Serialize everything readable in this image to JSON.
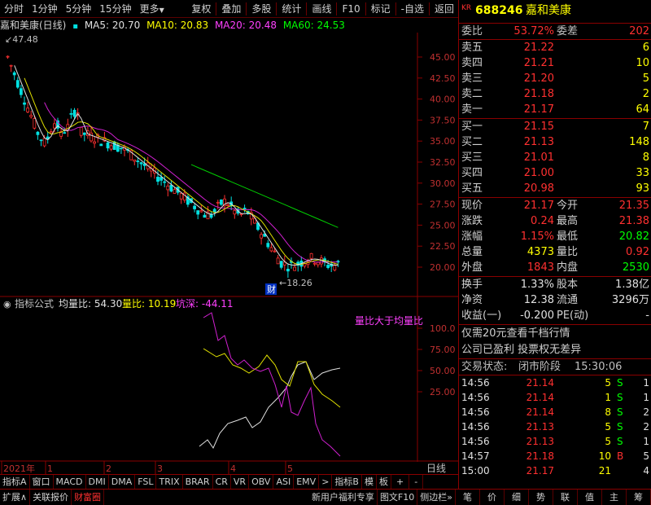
{
  "toolbar": {
    "left": [
      "分时",
      "1分钟",
      "5分钟",
      "15分钟",
      "更多"
    ],
    "right": [
      "复权",
      "叠加",
      "多股",
      "统计",
      "画线",
      "F10",
      "标记",
      "-自选",
      "返回"
    ]
  },
  "chart_header": {
    "name": "嘉和美康(日线)",
    "ma5": "MA5: 20.70",
    "ma10": "MA10: 20.83",
    "ma20": "MA20: 20.48",
    "ma60": "MA60: 24.53"
  },
  "price_axis": [
    "45.00",
    "42.50",
    "40.00",
    "37.50",
    "35.00",
    "32.50",
    "30.00",
    "27.50",
    "25.00",
    "22.50",
    "20.00"
  ],
  "max_label": "47.48",
  "min_label": "18.26",
  "cai_label": "财",
  "indicator": {
    "title": "指标公式",
    "junliang": "均量比: 54.30",
    "liangbi": "量比: 10.19",
    "kengshen": "坑深: -44.11",
    "annotation": "量比大于均量比",
    "axis": [
      "100.0",
      "75.00",
      "50.00",
      "25.00"
    ]
  },
  "date_axis": [
    "2021年",
    "1",
    "2",
    "3",
    "4",
    "5"
  ],
  "date_axis_right": "日线",
  "tabs": [
    "指标A",
    "窗口",
    "MACD",
    "DMI",
    "DMA",
    "FSL",
    "TRIX",
    "BRAR",
    "CR",
    "VR",
    "OBV",
    "ASI",
    "EMV",
    ">",
    "指标B",
    "模",
    "板",
    "+",
    "-"
  ],
  "status_bar": {
    "left": [
      "扩展∧",
      "关联报价",
      "财富圈"
    ],
    "mid": [
      "新用户福利专享",
      "图文F10",
      "侧边栏"
    ],
    "right": [
      "笔",
      "价",
      "细",
      "势",
      "联",
      "值",
      "主",
      "筹"
    ]
  },
  "quote": {
    "badge": "KR",
    "code": "688246",
    "name": "嘉和美康",
    "weibi_label": "委比",
    "weibi": "53.72%",
    "weicha_label": "委差",
    "weicha": "202",
    "asks": [
      {
        "label": "卖五",
        "price": "21.22",
        "vol": "6"
      },
      {
        "label": "卖四",
        "price": "21.21",
        "vol": "10"
      },
      {
        "label": "卖三",
        "price": "21.20",
        "vol": "5"
      },
      {
        "label": "卖二",
        "price": "21.18",
        "vol": "2"
      },
      {
        "label": "卖一",
        "price": "21.17",
        "vol": "64"
      }
    ],
    "bids": [
      {
        "label": "买一",
        "price": "21.15",
        "vol": "7"
      },
      {
        "label": "买二",
        "price": "21.13",
        "vol": "148"
      },
      {
        "label": "买三",
        "price": "21.01",
        "vol": "8"
      },
      {
        "label": "买四",
        "price": "21.00",
        "vol": "33"
      },
      {
        "label": "买五",
        "price": "20.98",
        "vol": "93"
      }
    ],
    "stats": [
      {
        "l1": "现价",
        "v1": "21.17",
        "l2": "今开",
        "v2": "21.35"
      },
      {
        "l1": "涨跌",
        "v1": "0.24",
        "l2": "最高",
        "v2": "21.38"
      },
      {
        "l1": "涨幅",
        "v1": "1.15%",
        "l2": "最低",
        "v2": "20.82"
      },
      {
        "l1": "总量",
        "v1": "4373",
        "l2": "量比",
        "v2": "0.92"
      },
      {
        "l1": "外盘",
        "v1": "1843",
        "l2": "内盘",
        "v2": "2530"
      }
    ],
    "stats2": [
      {
        "l1": "换手",
        "v1": "1.33%",
        "l2": "股本",
        "v2": "1.38亿"
      },
      {
        "l1": "净资",
        "v1": "12.38",
        "l2": "流通",
        "v2": "3296万"
      },
      {
        "l1": "收益(一)",
        "v1": "-0.200",
        "l2": "PE(动)",
        "v2": "-"
      }
    ],
    "promo1": "仅需20元查看千档行情",
    "promo2": "公司已盈利 投票权无差异",
    "trade_state_label": "交易状态:",
    "trade_state": "闭市阶段",
    "trade_time": "15:30:06",
    "ticks": [
      {
        "t": "14:56",
        "p": "21.14",
        "v": "5",
        "s": "S",
        "n": "1"
      },
      {
        "t": "14:56",
        "p": "21.14",
        "v": "1",
        "s": "S",
        "n": "1"
      },
      {
        "t": "14:56",
        "p": "21.14",
        "v": "8",
        "s": "S",
        "n": "2"
      },
      {
        "t": "14:56",
        "p": "21.13",
        "v": "5",
        "s": "S",
        "n": "2"
      },
      {
        "t": "14:56",
        "p": "21.13",
        "v": "5",
        "s": "S",
        "n": "1"
      },
      {
        "t": "14:57",
        "p": "21.18",
        "v": "10",
        "s": "B",
        "n": "5"
      },
      {
        "t": "15:00",
        "p": "21.17",
        "v": "21",
        "s": "",
        "n": "4"
      }
    ]
  },
  "colors": {
    "red": "#ff3030",
    "green": "#00ff00",
    "yellow": "#ffff00",
    "cyan": "#00e0e0",
    "magenta": "#ff40ff",
    "grid": "#8a0000"
  }
}
